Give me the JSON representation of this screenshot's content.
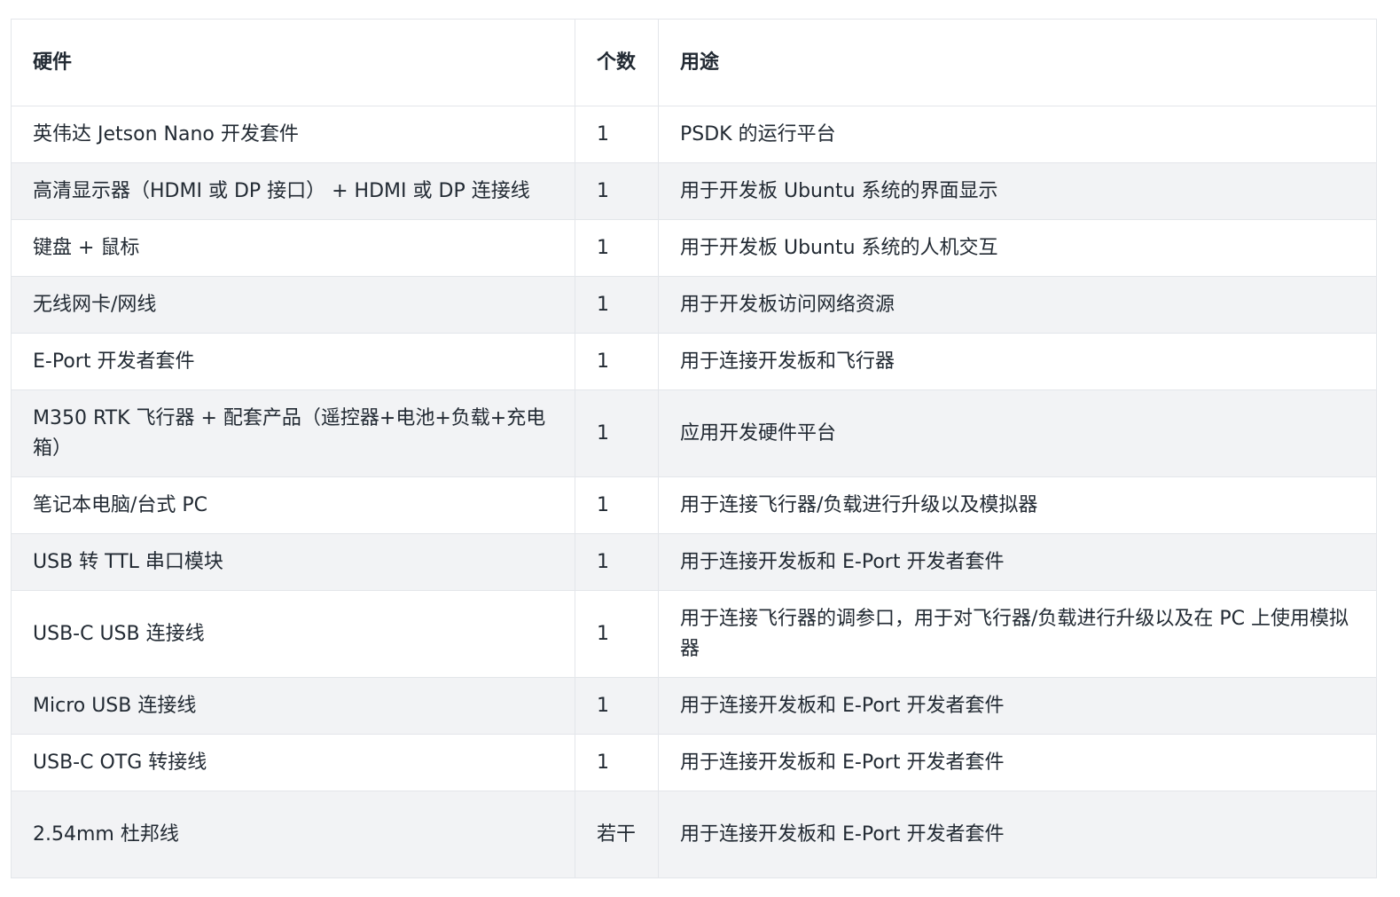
{
  "table": {
    "headers": [
      "硬件",
      "个数",
      "用途"
    ],
    "rows": [
      {
        "hardware": "英伟达 Jetson Nano 开发套件",
        "count": "1",
        "usage": "PSDK 的运行平台"
      },
      {
        "hardware": "高清显示器（HDMI 或 DP 接口） + HDMI 或 DP 连接线",
        "count": "1",
        "usage": "用于开发板 Ubuntu 系统的界面显示"
      },
      {
        "hardware": "键盘 + 鼠标",
        "count": "1",
        "usage": "用于开发板 Ubuntu 系统的人机交互"
      },
      {
        "hardware": "无线网卡/网线",
        "count": "1",
        "usage": "用于开发板访问网络资源"
      },
      {
        "hardware": "E-Port 开发者套件",
        "count": "1",
        "usage": "用于连接开发板和飞行器"
      },
      {
        "hardware": "M350 RTK 飞行器 + 配套产品（遥控器+电池+负载+充电箱）",
        "count": "1",
        "usage": "应用开发硬件平台"
      },
      {
        "hardware": "笔记本电脑/台式 PC",
        "count": "1",
        "usage": "用于连接飞行器/负载进行升级以及模拟器"
      },
      {
        "hardware": "USB 转 TTL 串口模块",
        "count": "1",
        "usage": "用于连接开发板和 E-Port 开发者套件"
      },
      {
        "hardware": "USB-C USB 连接线",
        "count": "1",
        "usage": "用于连接飞行器的调参口，用于对飞行器/负载进行升级以及在 PC 上使用模拟器"
      },
      {
        "hardware": "Micro USB 连接线",
        "count": "1",
        "usage": "用于连接开发板和 E-Port 开发者套件"
      },
      {
        "hardware": "USB-C OTG 转接线",
        "count": "1",
        "usage": "用于连接开发板和 E-Port 开发者套件"
      },
      {
        "hardware": "2.54mm 杜邦线",
        "count": "若干",
        "usage": "用于连接开发板和 E-Port 开发者套件"
      }
    ]
  }
}
